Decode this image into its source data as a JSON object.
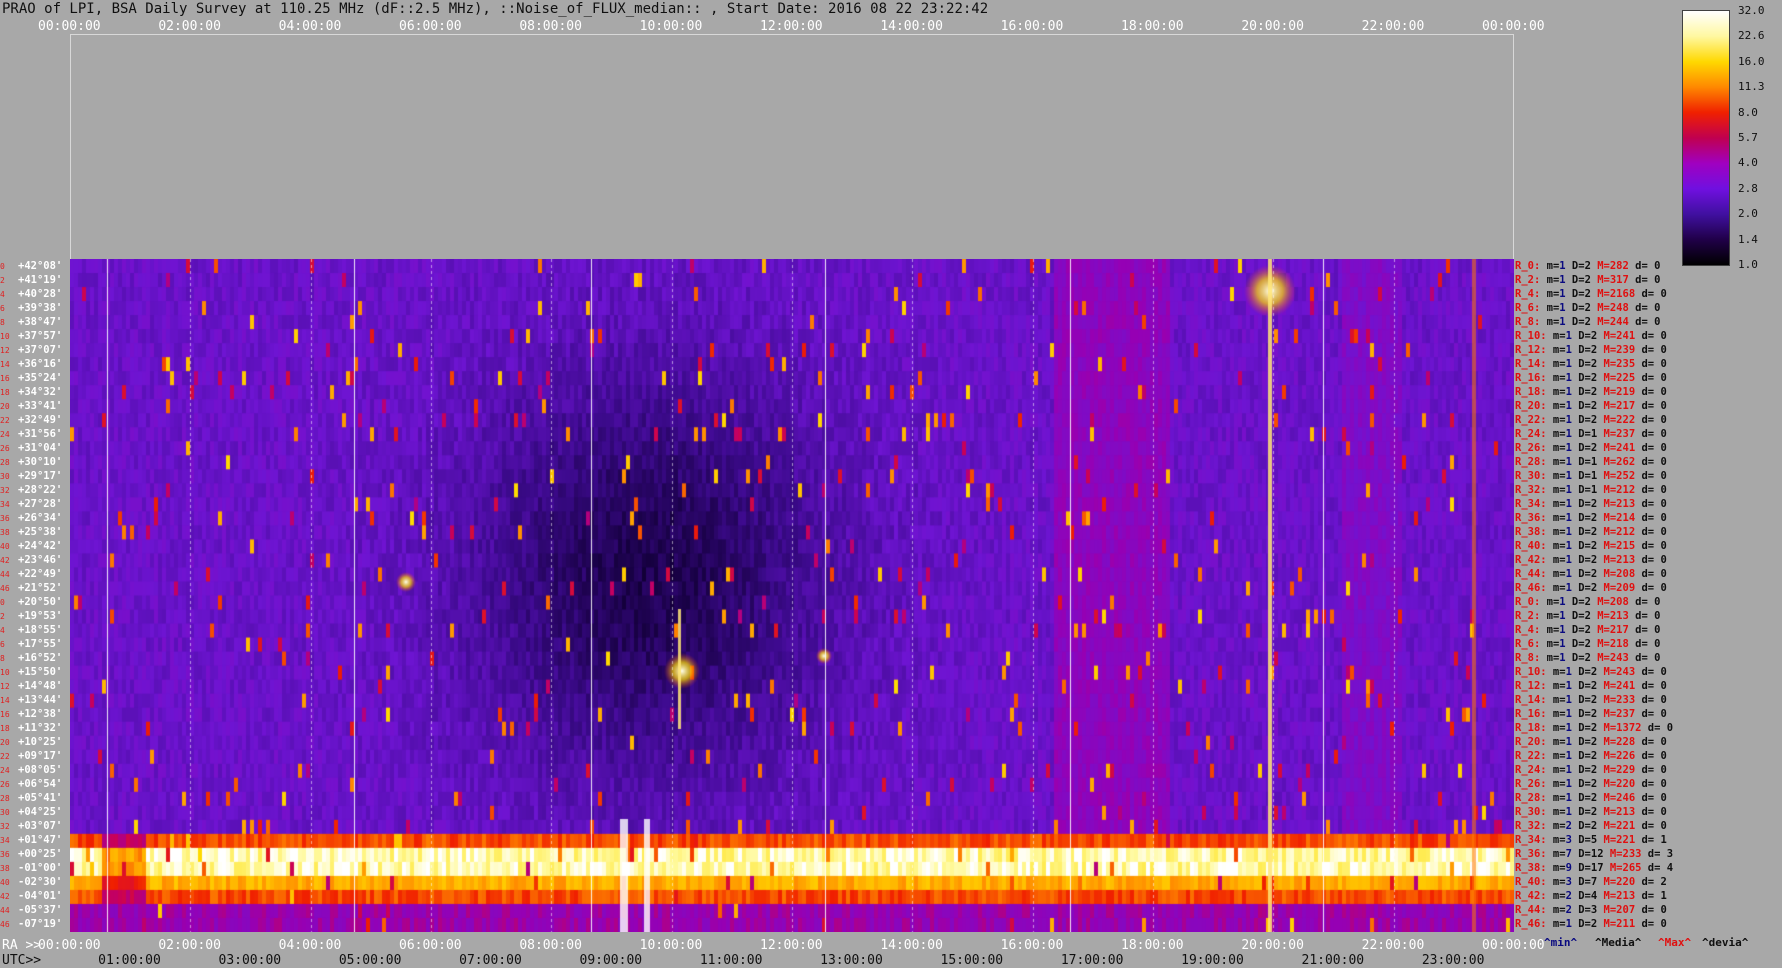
{
  "title": "PRAO of LPI, BSA Daily Survey at 110.25 MHz (dF::2.5 MHz), ::Noise_of_FLUX_median:: , Start Date: 2016 08 22 23:22:42",
  "top_ticks": [
    "00:00:00",
    "02:00:00",
    "04:00:00",
    "06:00:00",
    "08:00:00",
    "10:00:00",
    "12:00:00",
    "14:00:00",
    "16:00:00",
    "18:00:00",
    "20:00:00",
    "22:00:00",
    "00:00:00"
  ],
  "bottom_ra_label": "RA >>",
  "bottom_ra_ticks": [
    "00:00:00",
    "02:00:00",
    "04:00:00",
    "06:00:00",
    "08:00:00",
    "10:00:00",
    "12:00:00",
    "14:00:00",
    "16:00:00",
    "18:00:00",
    "20:00:00",
    "22:00:00",
    "00:00:00"
  ],
  "bottom_utc_label": "UTC>>",
  "bottom_utc_ticks": [
    "01:00:00",
    "03:00:00",
    "05:00:00",
    "07:00:00",
    "09:00:00",
    "11:00:00",
    "13:00:00",
    "15:00:00",
    "17:00:00",
    "19:00:00",
    "21:00:00",
    "23:00:00"
  ],
  "stats_legend": {
    "min": "^min^",
    "median": "^Media^",
    "max": "^Max^",
    "dev": "^devia^"
  },
  "colorbar": {
    "ticks": [
      "32.0",
      "22.6",
      "16.0",
      "11.3",
      "8.0",
      "5.7",
      "4.0",
      "2.8",
      "2.0",
      "1.4",
      "1.0"
    ],
    "colors": [
      "#ffffff",
      "#fff8a0",
      "#ffd800",
      "#ff8800",
      "#f02000",
      "#c00050",
      "#a000c0",
      "#7010e0",
      "#4010a0",
      "#200048",
      "#000000"
    ]
  },
  "chart_data": {
    "type": "heatmap",
    "x_axis": "RA / UTC (hours)",
    "declinations": [
      "+42°08'",
      "+41°19'",
      "+40°28'",
      "+39°38'",
      "+38°47'",
      "+37°57'",
      "+37°07'",
      "+36°16'",
      "+35°24'",
      "+34°32'",
      "+33°41'",
      "+32°49'",
      "+31°56'",
      "+31°04'",
      "+30°10'",
      "+29°17'",
      "+28°22'",
      "+27°28'",
      "+26°34'",
      "+25°38'",
      "+24°42'",
      "+23°46'",
      "+22°49'",
      "+21°52'",
      "+20°50'",
      "+19°53'",
      "+18°55'",
      "+17°55'",
      "+16°52'",
      "+15°50'",
      "+14°48'",
      "+13°44'",
      "+12°38'",
      "+11°32'",
      "+10°25'",
      "+09°17'",
      "+08°05'",
      "+06°54'",
      "+05°41'",
      "+04°25'",
      "+03°07'",
      "+01°47'",
      "+00°25'",
      "-01°00'",
      "-02°30'",
      "-04°01'",
      "-05°37'",
      "-07°19'"
    ],
    "row_numbers": [
      "0",
      "2",
      "4",
      "6",
      "8",
      "10",
      "12",
      "14",
      "16",
      "18",
      "20",
      "22",
      "24",
      "26",
      "28",
      "30",
      "32",
      "34",
      "36",
      "38",
      "40",
      "42",
      "44",
      "46",
      "0",
      "2",
      "4",
      "6",
      "8",
      "10",
      "12",
      "14",
      "16",
      "18",
      "20",
      "22",
      "24",
      "26",
      "28",
      "30",
      "32",
      "34",
      "36",
      "38",
      "40",
      "42",
      "44",
      "46"
    ],
    "stats": [
      {
        "r": "R_0:",
        "m": "1",
        "D": "2",
        "M": "282",
        "d": "0"
      },
      {
        "r": "R_2:",
        "m": "1",
        "D": "2",
        "M": "317",
        "d": "0"
      },
      {
        "r": "R_4:",
        "m": "1",
        "D": "2",
        "M": "2168",
        "d": "0"
      },
      {
        "r": "R_6:",
        "m": "1",
        "D": "2",
        "M": "248",
        "d": "0"
      },
      {
        "r": "R_8:",
        "m": "1",
        "D": "2",
        "M": "244",
        "d": "0"
      },
      {
        "r": "R_10:",
        "m": "1",
        "D": "2",
        "M": "241",
        "d": "0"
      },
      {
        "r": "R_12:",
        "m": "1",
        "D": "2",
        "M": "239",
        "d": "0"
      },
      {
        "r": "R_14:",
        "m": "1",
        "D": "2",
        "M": "235",
        "d": "0"
      },
      {
        "r": "R_16:",
        "m": "1",
        "D": "2",
        "M": "225",
        "d": "0"
      },
      {
        "r": "R_18:",
        "m": "1",
        "D": "2",
        "M": "219",
        "d": "0"
      },
      {
        "r": "R_20:",
        "m": "1",
        "D": "2",
        "M": "217",
        "d": "0"
      },
      {
        "r": "R_22:",
        "m": "1",
        "D": "2",
        "M": "222",
        "d": "0"
      },
      {
        "r": "R_24:",
        "m": "1",
        "D": "1",
        "M": "237",
        "d": "0"
      },
      {
        "r": "R_26:",
        "m": "1",
        "D": "2",
        "M": "241",
        "d": "0"
      },
      {
        "r": "R_28:",
        "m": "1",
        "D": "1",
        "M": "262",
        "d": "0"
      },
      {
        "r": "R_30:",
        "m": "1",
        "D": "1",
        "M": "252",
        "d": "0"
      },
      {
        "r": "R_32:",
        "m": "1",
        "D": "1",
        "M": "212",
        "d": "0"
      },
      {
        "r": "R_34:",
        "m": "1",
        "D": "2",
        "M": "213",
        "d": "0"
      },
      {
        "r": "R_36:",
        "m": "1",
        "D": "2",
        "M": "214",
        "d": "0"
      },
      {
        "r": "R_38:",
        "m": "1",
        "D": "2",
        "M": "212",
        "d": "0"
      },
      {
        "r": "R_40:",
        "m": "1",
        "D": "2",
        "M": "215",
        "d": "0"
      },
      {
        "r": "R_42:",
        "m": "1",
        "D": "2",
        "M": "213",
        "d": "0"
      },
      {
        "r": "R_44:",
        "m": "1",
        "D": "2",
        "M": "208",
        "d": "0"
      },
      {
        "r": "R_46:",
        "m": "1",
        "D": "2",
        "M": "209",
        "d": "0"
      },
      {
        "r": "R_0:",
        "m": "1",
        "D": "2",
        "M": "208",
        "d": "0"
      },
      {
        "r": "R_2:",
        "m": "1",
        "D": "2",
        "M": "213",
        "d": "0"
      },
      {
        "r": "R_4:",
        "m": "1",
        "D": "2",
        "M": "217",
        "d": "0"
      },
      {
        "r": "R_6:",
        "m": "1",
        "D": "2",
        "M": "218",
        "d": "0"
      },
      {
        "r": "R_8:",
        "m": "1",
        "D": "2",
        "M": "243",
        "d": "0"
      },
      {
        "r": "R_10:",
        "m": "1",
        "D": "2",
        "M": "243",
        "d": "0"
      },
      {
        "r": "R_12:",
        "m": "1",
        "D": "2",
        "M": "241",
        "d": "0"
      },
      {
        "r": "R_14:",
        "m": "1",
        "D": "2",
        "M": "233",
        "d": "0"
      },
      {
        "r": "R_16:",
        "m": "1",
        "D": "2",
        "M": "237",
        "d": "0"
      },
      {
        "r": "R_18:",
        "m": "1",
        "D": "2",
        "M": "1372",
        "d": "0"
      },
      {
        "r": "R_20:",
        "m": "1",
        "D": "2",
        "M": "228",
        "d": "0"
      },
      {
        "r": "R_22:",
        "m": "1",
        "D": "2",
        "M": "226",
        "d": "0"
      },
      {
        "r": "R_24:",
        "m": "1",
        "D": "2",
        "M": "229",
        "d": "0"
      },
      {
        "r": "R_26:",
        "m": "1",
        "D": "2",
        "M": "220",
        "d": "0"
      },
      {
        "r": "R_28:",
        "m": "1",
        "D": "2",
        "M": "246",
        "d": "0"
      },
      {
        "r": "R_30:",
        "m": "1",
        "D": "2",
        "M": "213",
        "d": "0"
      },
      {
        "r": "R_32:",
        "m": "2",
        "D": "2",
        "M": "221",
        "d": "0"
      },
      {
        "r": "R_34:",
        "m": "3",
        "D": "5",
        "M": "221",
        "d": "1"
      },
      {
        "r": "R_36:",
        "m": "7",
        "D": "12",
        "M": "233",
        "d": "3"
      },
      {
        "r": "R_38:",
        "m": "9",
        "D": "17",
        "M": "265",
        "d": "4"
      },
      {
        "r": "R_40:",
        "m": "3",
        "D": "7",
        "M": "220",
        "d": "2"
      },
      {
        "r": "R_42:",
        "m": "2",
        "D": "4",
        "M": "213",
        "d": "1"
      },
      {
        "r": "R_44:",
        "m": "2",
        "D": "3",
        "M": "207",
        "d": "0"
      },
      {
        "r": "R_46:",
        "m": "1",
        "D": "2",
        "M": "211",
        "d": "0"
      }
    ]
  }
}
